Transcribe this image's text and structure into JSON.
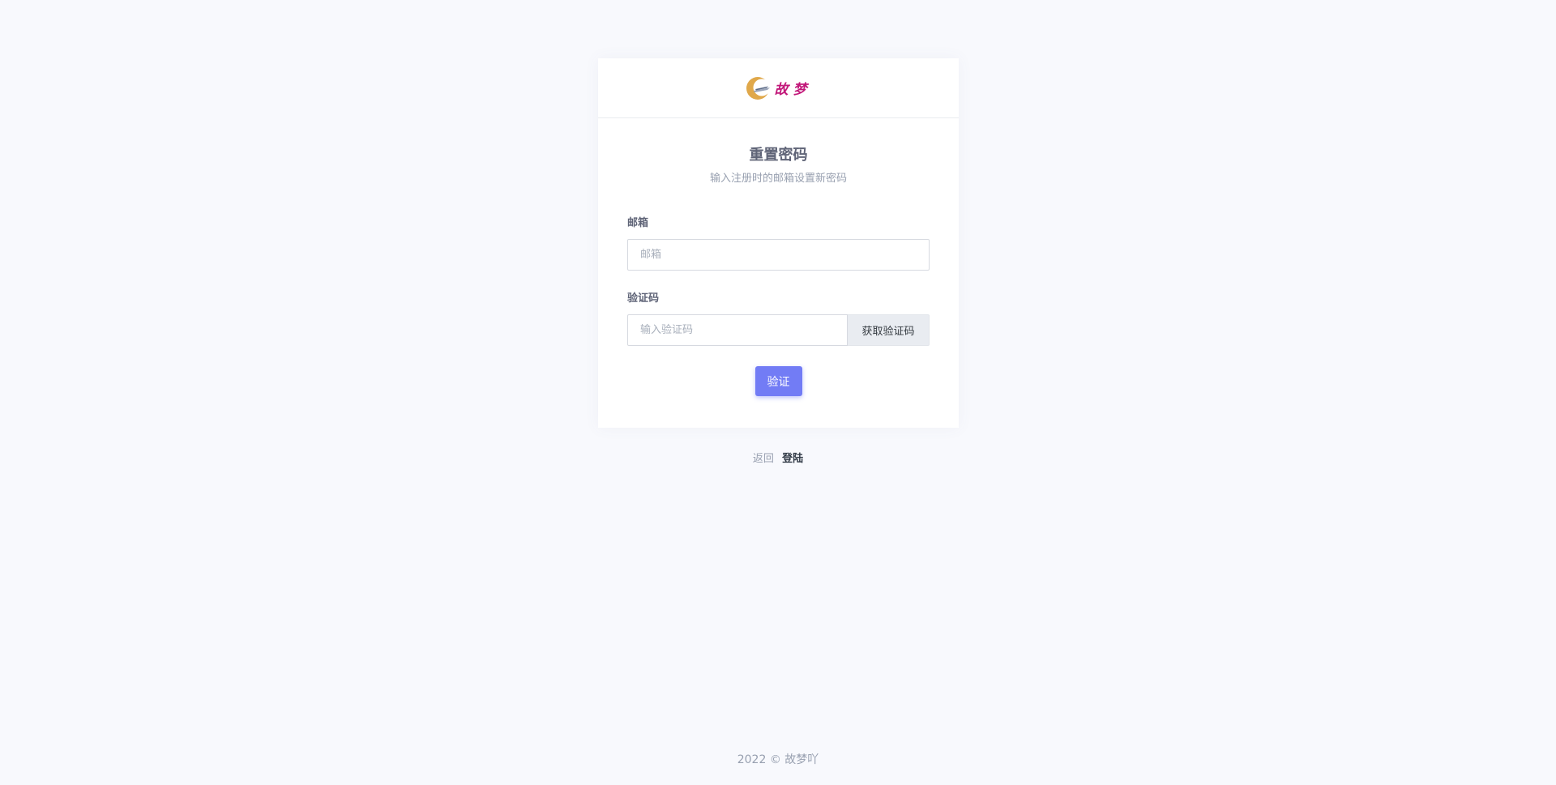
{
  "logo": {
    "text": "故梦",
    "icon": "crescent-logo-icon"
  },
  "form": {
    "title": "重置密码",
    "subtitle": "输入注册时的邮箱设置新密码",
    "email": {
      "label": "邮箱",
      "placeholder": "邮箱",
      "value": ""
    },
    "code": {
      "label": "验证码",
      "placeholder": "输入验证码",
      "value": "",
      "button_label": "获取验证码"
    },
    "submit_label": "验证"
  },
  "back": {
    "text": "返回",
    "link_label": "登陆"
  },
  "footer": {
    "text": "2022 © 故梦吖"
  },
  "colors": {
    "background": "#f8f9fd",
    "primary": "#727cf5",
    "logo_text": "#c2187a",
    "logo_mark": "#e0a84a"
  }
}
